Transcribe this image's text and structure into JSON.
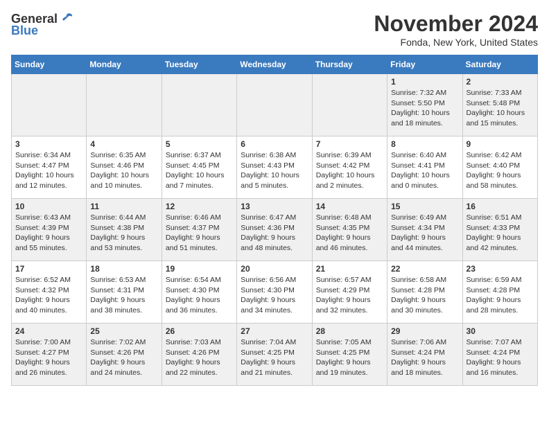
{
  "header": {
    "logo_general": "General",
    "logo_blue": "Blue",
    "month_title": "November 2024",
    "location": "Fonda, New York, United States"
  },
  "weekdays": [
    "Sunday",
    "Monday",
    "Tuesday",
    "Wednesday",
    "Thursday",
    "Friday",
    "Saturday"
  ],
  "weeks": [
    [
      {
        "day": "",
        "sunrise": "",
        "sunset": "",
        "daylight": ""
      },
      {
        "day": "",
        "sunrise": "",
        "sunset": "",
        "daylight": ""
      },
      {
        "day": "",
        "sunrise": "",
        "sunset": "",
        "daylight": ""
      },
      {
        "day": "",
        "sunrise": "",
        "sunset": "",
        "daylight": ""
      },
      {
        "day": "",
        "sunrise": "",
        "sunset": "",
        "daylight": ""
      },
      {
        "day": "1",
        "sunrise": "Sunrise: 7:32 AM",
        "sunset": "Sunset: 5:50 PM",
        "daylight": "Daylight: 10 hours and 18 minutes."
      },
      {
        "day": "2",
        "sunrise": "Sunrise: 7:33 AM",
        "sunset": "Sunset: 5:48 PM",
        "daylight": "Daylight: 10 hours and 15 minutes."
      }
    ],
    [
      {
        "day": "3",
        "sunrise": "Sunrise: 6:34 AM",
        "sunset": "Sunset: 4:47 PM",
        "daylight": "Daylight: 10 hours and 12 minutes."
      },
      {
        "day": "4",
        "sunrise": "Sunrise: 6:35 AM",
        "sunset": "Sunset: 4:46 PM",
        "daylight": "Daylight: 10 hours and 10 minutes."
      },
      {
        "day": "5",
        "sunrise": "Sunrise: 6:37 AM",
        "sunset": "Sunset: 4:45 PM",
        "daylight": "Daylight: 10 hours and 7 minutes."
      },
      {
        "day": "6",
        "sunrise": "Sunrise: 6:38 AM",
        "sunset": "Sunset: 4:43 PM",
        "daylight": "Daylight: 10 hours and 5 minutes."
      },
      {
        "day": "7",
        "sunrise": "Sunrise: 6:39 AM",
        "sunset": "Sunset: 4:42 PM",
        "daylight": "Daylight: 10 hours and 2 minutes."
      },
      {
        "day": "8",
        "sunrise": "Sunrise: 6:40 AM",
        "sunset": "Sunset: 4:41 PM",
        "daylight": "Daylight: 10 hours and 0 minutes."
      },
      {
        "day": "9",
        "sunrise": "Sunrise: 6:42 AM",
        "sunset": "Sunset: 4:40 PM",
        "daylight": "Daylight: 9 hours and 58 minutes."
      }
    ],
    [
      {
        "day": "10",
        "sunrise": "Sunrise: 6:43 AM",
        "sunset": "Sunset: 4:39 PM",
        "daylight": "Daylight: 9 hours and 55 minutes."
      },
      {
        "day": "11",
        "sunrise": "Sunrise: 6:44 AM",
        "sunset": "Sunset: 4:38 PM",
        "daylight": "Daylight: 9 hours and 53 minutes."
      },
      {
        "day": "12",
        "sunrise": "Sunrise: 6:46 AM",
        "sunset": "Sunset: 4:37 PM",
        "daylight": "Daylight: 9 hours and 51 minutes."
      },
      {
        "day": "13",
        "sunrise": "Sunrise: 6:47 AM",
        "sunset": "Sunset: 4:36 PM",
        "daylight": "Daylight: 9 hours and 48 minutes."
      },
      {
        "day": "14",
        "sunrise": "Sunrise: 6:48 AM",
        "sunset": "Sunset: 4:35 PM",
        "daylight": "Daylight: 9 hours and 46 minutes."
      },
      {
        "day": "15",
        "sunrise": "Sunrise: 6:49 AM",
        "sunset": "Sunset: 4:34 PM",
        "daylight": "Daylight: 9 hours and 44 minutes."
      },
      {
        "day": "16",
        "sunrise": "Sunrise: 6:51 AM",
        "sunset": "Sunset: 4:33 PM",
        "daylight": "Daylight: 9 hours and 42 minutes."
      }
    ],
    [
      {
        "day": "17",
        "sunrise": "Sunrise: 6:52 AM",
        "sunset": "Sunset: 4:32 PM",
        "daylight": "Daylight: 9 hours and 40 minutes."
      },
      {
        "day": "18",
        "sunrise": "Sunrise: 6:53 AM",
        "sunset": "Sunset: 4:31 PM",
        "daylight": "Daylight: 9 hours and 38 minutes."
      },
      {
        "day": "19",
        "sunrise": "Sunrise: 6:54 AM",
        "sunset": "Sunset: 4:30 PM",
        "daylight": "Daylight: 9 hours and 36 minutes."
      },
      {
        "day": "20",
        "sunrise": "Sunrise: 6:56 AM",
        "sunset": "Sunset: 4:30 PM",
        "daylight": "Daylight: 9 hours and 34 minutes."
      },
      {
        "day": "21",
        "sunrise": "Sunrise: 6:57 AM",
        "sunset": "Sunset: 4:29 PM",
        "daylight": "Daylight: 9 hours and 32 minutes."
      },
      {
        "day": "22",
        "sunrise": "Sunrise: 6:58 AM",
        "sunset": "Sunset: 4:28 PM",
        "daylight": "Daylight: 9 hours and 30 minutes."
      },
      {
        "day": "23",
        "sunrise": "Sunrise: 6:59 AM",
        "sunset": "Sunset: 4:28 PM",
        "daylight": "Daylight: 9 hours and 28 minutes."
      }
    ],
    [
      {
        "day": "24",
        "sunrise": "Sunrise: 7:00 AM",
        "sunset": "Sunset: 4:27 PM",
        "daylight": "Daylight: 9 hours and 26 minutes."
      },
      {
        "day": "25",
        "sunrise": "Sunrise: 7:02 AM",
        "sunset": "Sunset: 4:26 PM",
        "daylight": "Daylight: 9 hours and 24 minutes."
      },
      {
        "day": "26",
        "sunrise": "Sunrise: 7:03 AM",
        "sunset": "Sunset: 4:26 PM",
        "daylight": "Daylight: 9 hours and 22 minutes."
      },
      {
        "day": "27",
        "sunrise": "Sunrise: 7:04 AM",
        "sunset": "Sunset: 4:25 PM",
        "daylight": "Daylight: 9 hours and 21 minutes."
      },
      {
        "day": "28",
        "sunrise": "Sunrise: 7:05 AM",
        "sunset": "Sunset: 4:25 PM",
        "daylight": "Daylight: 9 hours and 19 minutes."
      },
      {
        "day": "29",
        "sunrise": "Sunrise: 7:06 AM",
        "sunset": "Sunset: 4:24 PM",
        "daylight": "Daylight: 9 hours and 18 minutes."
      },
      {
        "day": "30",
        "sunrise": "Sunrise: 7:07 AM",
        "sunset": "Sunset: 4:24 PM",
        "daylight": "Daylight: 9 hours and 16 minutes."
      }
    ]
  ]
}
